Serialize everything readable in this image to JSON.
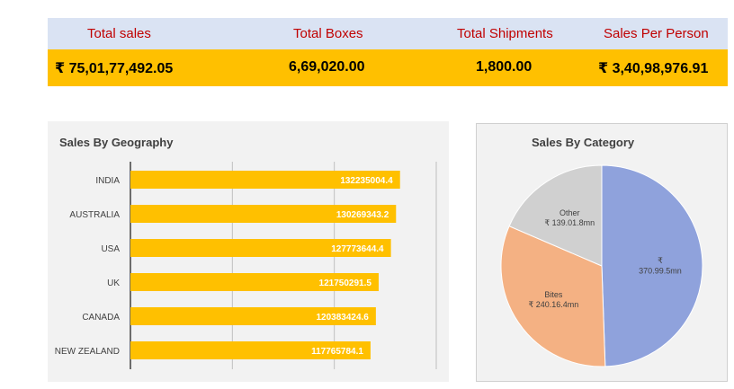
{
  "kpis": [
    {
      "label": "Total sales",
      "value": "₹ 75,01,77,492.05"
    },
    {
      "label": "Total Boxes",
      "value": "6,69,020.00"
    },
    {
      "label": "Total Shipments",
      "value": "1,800.00"
    },
    {
      "label": "Sales Per Person",
      "value": "₹ 3,40,98,976.91"
    }
  ],
  "colors": {
    "header_bg": "#dae3f3",
    "values_bg": "#ffc000",
    "label_text": "#c00000",
    "bar": "#ffc000"
  },
  "chart_data": [
    {
      "type": "bar",
      "orientation": "horizontal",
      "title": "Sales By Geography",
      "categories": [
        "INDIA",
        "AUSTRALIA",
        "USA",
        "UK",
        "CANADA",
        "NEW ZEALAND"
      ],
      "values": [
        132235004.4,
        130269343.2,
        127773644.4,
        121750291.5,
        120383424.6,
        117765784.1
      ],
      "data_labels": [
        "132235004.4",
        "130269343.2",
        "127773644.4",
        "121750291.5",
        "120383424.6",
        "117765784.1"
      ],
      "xlim": [
        0,
        150000000
      ],
      "grid": true
    },
    {
      "type": "pie",
      "title": "Sales By Category",
      "slices": [
        {
          "label_lines": [
            "₹",
            "370.99.5mn"
          ],
          "value": 370.995,
          "color": "#8fa2dc"
        },
        {
          "label_lines": [
            "Bites",
            "₹ 240.16.4mn"
          ],
          "value": 240.164,
          "color": "#f4b183"
        },
        {
          "label_lines": [
            "Other",
            "₹ 139.01.8mn"
          ],
          "value": 139.018,
          "color": "#d0d0d0"
        }
      ]
    }
  ]
}
